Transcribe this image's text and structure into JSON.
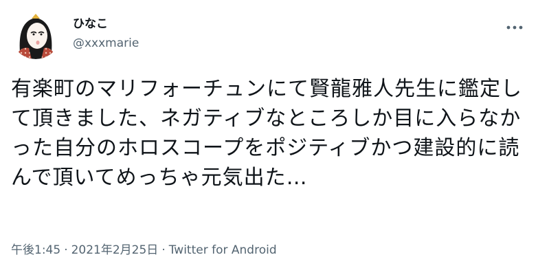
{
  "tweet": {
    "author": {
      "display_name": "ひなこ",
      "handle": "@xxxmarie",
      "avatar_icon": "avatar-illustration-icon"
    },
    "more_icon": "more-options-icon",
    "text": "有楽町のマリフォーチュンにて賢龍雅人先生に鑑定して頂きました、ネガティブなところしか目に入らなかった自分のホロスコープをポジティブかつ建設的に読んで頂いてめっちゃ元気出た…",
    "time": "午後1:45",
    "date": "2021年2月25日",
    "separator": "·",
    "source": "Twitter for Android"
  },
  "colors": {
    "text_primary": "#0f1419",
    "text_secondary": "#536471",
    "background": "#ffffff"
  }
}
